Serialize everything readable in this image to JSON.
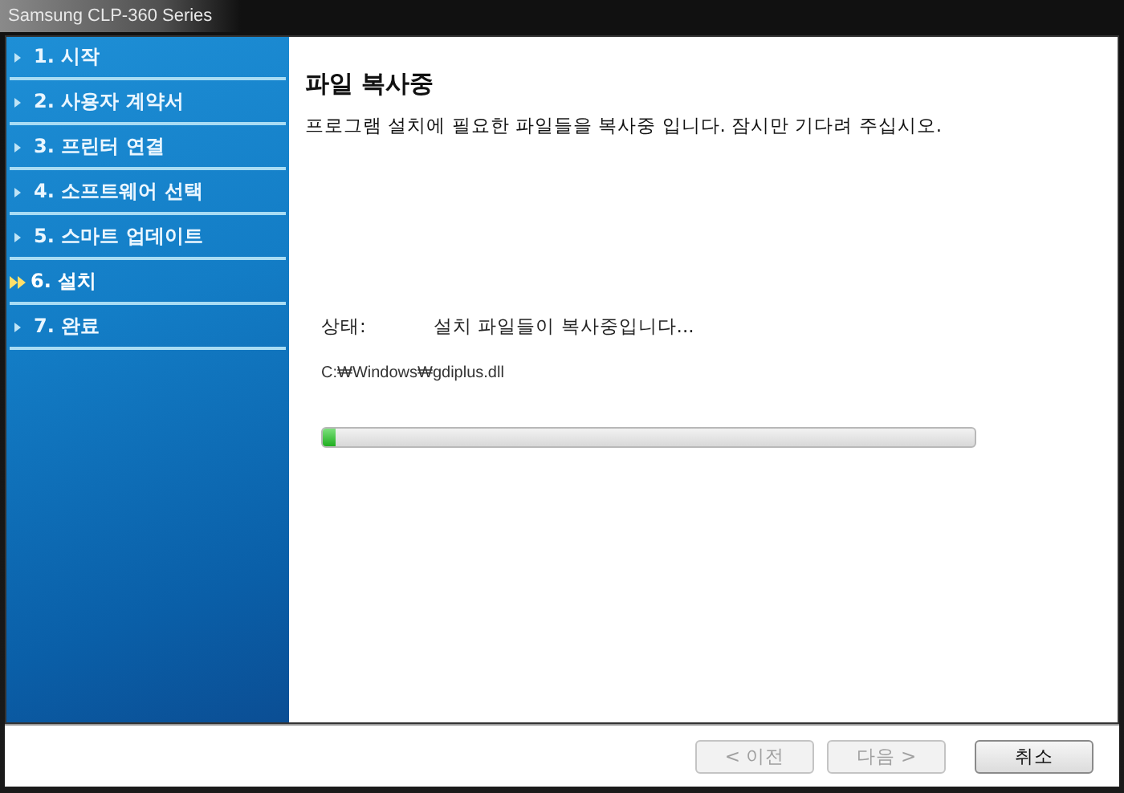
{
  "window": {
    "title": "Samsung CLP-360 Series"
  },
  "steps": [
    {
      "label": "1. 시작",
      "selected": false
    },
    {
      "label": "2. 사용자 계약서",
      "selected": false
    },
    {
      "label": "3. 프린터 연결",
      "selected": false
    },
    {
      "label": "4. 소프트웨어 선택",
      "selected": false
    },
    {
      "label": "5. 스마트 업데이트",
      "selected": false
    },
    {
      "label": "6. 설치",
      "selected": true
    },
    {
      "label": "7. 완료",
      "selected": false
    }
  ],
  "content": {
    "heading": "파일 복사중",
    "description": "프로그램 설치에 필요한 파일들을 복사중 입니다. 잠시만 기다려 주십시오.",
    "status_label": "상태:",
    "status_value": "설치 파일들이 복사중입니다...",
    "file_path": "C:₩Windows₩gdiplus.dll",
    "progress": {
      "level": 0.02
    }
  },
  "buttons": [
    {
      "label": "< 이전",
      "disabled": true
    },
    {
      "label": "다음 >",
      "disabled": true
    },
    {
      "label": "취소",
      "disabled": false
    }
  ]
}
